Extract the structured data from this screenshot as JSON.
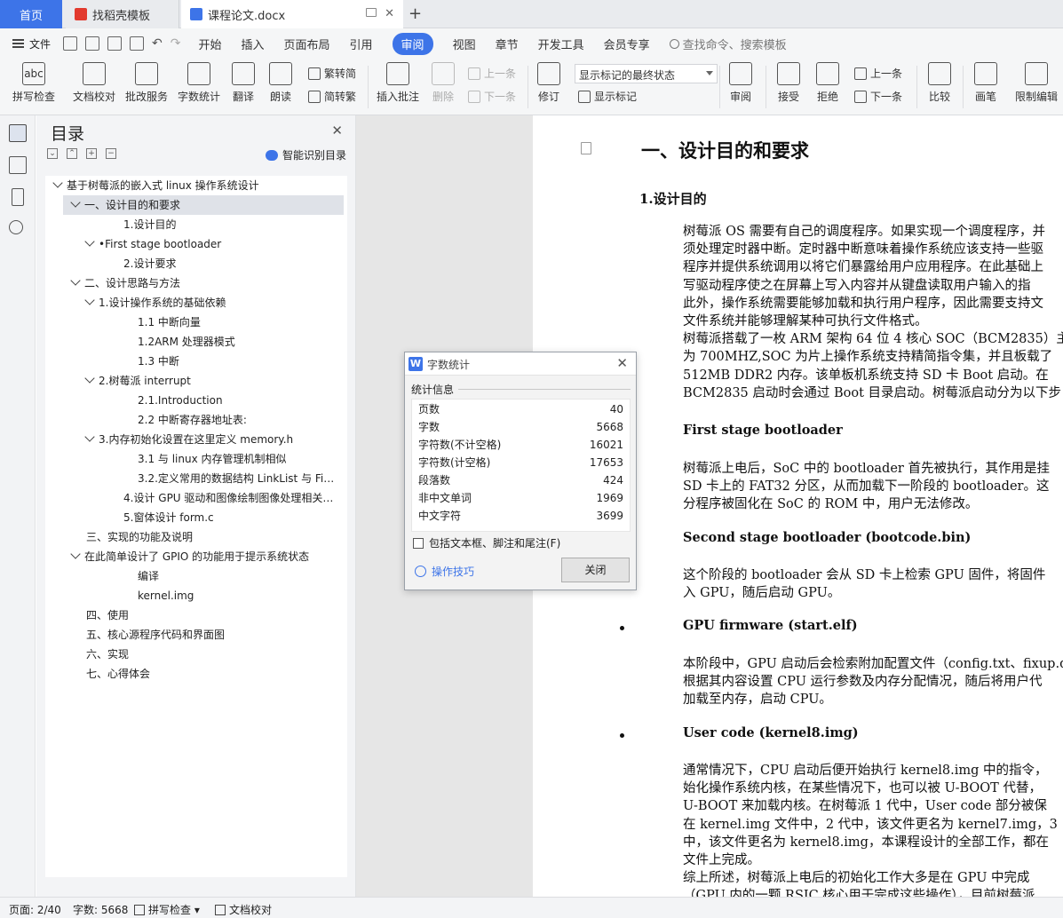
{
  "tabs": [
    {
      "label": "首页"
    },
    {
      "label": "找稻壳模板"
    },
    {
      "label": "课程论文.docx"
    }
  ],
  "menu": {
    "file": "文件",
    "items": [
      "开始",
      "插入",
      "页面布局",
      "引用",
      "审阅",
      "视图",
      "章节",
      "开发工具",
      "会员专享"
    ],
    "active": "审阅",
    "search_placeholder": "查找命令、搜索模板"
  },
  "ribbon": {
    "spellcheck": "拼写检查",
    "doc_check": "文档校对",
    "batch_service": "批改服务",
    "word_count": "字数统计",
    "translate": "翻译",
    "read_aloud": "朗读",
    "trad_to_simp": "繁转简",
    "simp_to_trad": "简转繁",
    "insert_comment": "插入批注",
    "delete": "删除",
    "prev_comment": "上一条",
    "next_comment": "下一条",
    "revise": "修订",
    "markup_select": "显示标记的最终状态",
    "show_markup": "显示标记",
    "review": "审阅",
    "accept": "接受",
    "reject": "拒绝",
    "prev": "上一条",
    "next": "下一条",
    "compare": "比较",
    "pen": "画笔",
    "restrict_edit": "限制编辑"
  },
  "toc": {
    "title": "目录",
    "smart_label": "智能识别目录",
    "items": [
      {
        "text": "基于树莓派的嵌入式 linux 操作系统设计",
        "level": 0,
        "caret": true
      },
      {
        "text": "一、设计目的和要求",
        "level": 1,
        "caret": true,
        "selected": true
      },
      {
        "text": "1.设计目的",
        "level": 3,
        "caret": false
      },
      {
        "text": "•First stage bootloader",
        "level": 2,
        "caret": true
      },
      {
        "text": "2.设计要求",
        "level": 3,
        "caret": false
      },
      {
        "text": "二、设计思路与方法",
        "level": 1,
        "caret": true
      },
      {
        "text": "1.设计操作系统的基础依赖",
        "level": 2,
        "caret": true
      },
      {
        "text": "1.1 中断向量",
        "level": 4,
        "caret": false
      },
      {
        "text": "1.2ARM 处理器模式",
        "level": 4,
        "caret": false
      },
      {
        "text": "1.3 中断",
        "level": 4,
        "caret": false
      },
      {
        "text": "2.树莓派  interrupt",
        "level": 2,
        "caret": true
      },
      {
        "text": "2.1.Introduction",
        "level": 4,
        "caret": false
      },
      {
        "text": "2.2 中断寄存器地址表:",
        "level": 4,
        "caret": false
      },
      {
        "text": "3.内存初始化设置在这里定义  memory.h",
        "level": 2,
        "caret": true
      },
      {
        "text": "3.1 与 linux 内存管理机制相似",
        "level": 4,
        "caret": false
      },
      {
        "text": "3.2.定义常用的数据结构 LinkList 与 FiFo ...",
        "level": 4,
        "caret": false
      },
      {
        "text": "4.设计 GPU 驱动和图像绘制图像处理相关函 ...",
        "level": 3,
        "caret": false
      },
      {
        "text": "5.窗体设计 form.c",
        "level": 3,
        "caret": false
      },
      {
        "text": "三、实现的功能及说明",
        "level": 1,
        "caret": false
      },
      {
        "text": "在此简单设计了 GPIO 的功能用于提示系统状态",
        "level": 1,
        "caret": true
      },
      {
        "text": "编译",
        "level": 4,
        "caret": false
      },
      {
        "text": "kernel.img",
        "level": 4,
        "caret": false
      },
      {
        "text": "四、使用",
        "level": 1,
        "caret": false
      },
      {
        "text": "五、核心源程序代码和界面图",
        "level": 1,
        "caret": false
      },
      {
        "text": "六、实现",
        "level": 1,
        "caret": false
      },
      {
        "text": "七、心得体会",
        "level": 1,
        "caret": false
      }
    ]
  },
  "dialog": {
    "title": "字数统计",
    "section": "统计信息",
    "stats": [
      {
        "label": "页数",
        "value": "40"
      },
      {
        "label": "字数",
        "value": "5668"
      },
      {
        "label": "字符数(不计空格)",
        "value": "16021"
      },
      {
        "label": "字符数(计空格)",
        "value": "17653"
      },
      {
        "label": "段落数",
        "value": "424"
      },
      {
        "label": "非中文单词",
        "value": "1969"
      },
      {
        "label": "中文字符",
        "value": "3699"
      }
    ],
    "include_label": "包括文本框、脚注和尾注(F)",
    "tips_label": "操作技巧",
    "close_label": "关闭"
  },
  "document": {
    "heading1": "一、设计目的和要求",
    "heading2": "1.设计目的",
    "lines": [
      "树莓派  OS 需要有自己的调度程序。如果实现一个调度程序，并",
      "须处理定时器中断。定时器中断意味着操作系统应该支持一些驱",
      "程序并提供系统调用以将它们暴露给用户应用程序。在此基础上",
      "写驱动程序使之在屏幕上写入内容并从键盘读取用户输入的指",
      "此外，操作系统需要能够加载和执行用户程序，因此需要支持文",
      "文件系统并能够理解某种可执行文件格式。",
      "树莓派搭载了一枚 ARM 架构 64 位 4 核心 SOC（BCM2835）主",
      "为 700MHZ,SOC 为片上操作系统支持精简指令集，并且板载了",
      "512MB DDR2 内存。该单板机系统支持 SD 卡 Boot 启动。在",
      "BCM2835 启动时会通过 Boot 目录启动。树莓派启动分为以下步"
    ],
    "first_stage_title": "First stage bootloader",
    "first_stage_lines": [
      "树莓派上电后，SoC  中的  bootloader  首先被执行，其作用是挂",
      "SD  卡上的  FAT32  分区，从而加载下一阶段的  bootloader。这",
      "分程序被固化在  SoC  的  ROM  中，用户无法修改。"
    ],
    "second_stage_title": "Second stage bootloader (bootcode.bin)",
    "second_stage_lines": [
      "这个阶段的  bootloader  会从  SD  卡上检索  GPU  固件，将固件",
      "入  GPU，随后启动  GPU。"
    ],
    "gpu_fw_title": "GPU firmware (start.elf)",
    "gpu_fw_lines": [
      "本阶段中，GPU  启动后会检索附加配置文件（config.txt、fixup.d",
      "根据其内容设置  CPU  运行参数及内存分配情况，随后将用户代",
      "加载至内存，启动  CPU。"
    ],
    "user_code_title": "User code (kernel8.img)",
    "user_code_lines": [
      "通常情况下，CPU  启动后便开始执行  kernel8.img  中的指令，",
      "始化操作系统内核，在某些情况下，也可以被  U-BOOT  代替，",
      "U-BOOT  来加载内核。在树莓派  1  代中，User code  部分被保",
      "在  kernel.img  文件中，2  代中，该文件更名为  kernel7.img，3",
      "中，该文件更名为  kernel8.img，本课程设计的全部工作，都在",
      "文件上完成。",
      "综上所述，树莓派上电后的初始化工作大多是在  GPU  中完成",
      "（GPU 内的一颗  RSIC  核心用于完成这些操作），目前树莓派"
    ]
  },
  "status": {
    "page": "页面: 2/40",
    "words": "字数: 5668",
    "spell": "拼写检查",
    "doc_check": "文档校对"
  },
  "colors": {
    "accent": "#3d74e8"
  }
}
